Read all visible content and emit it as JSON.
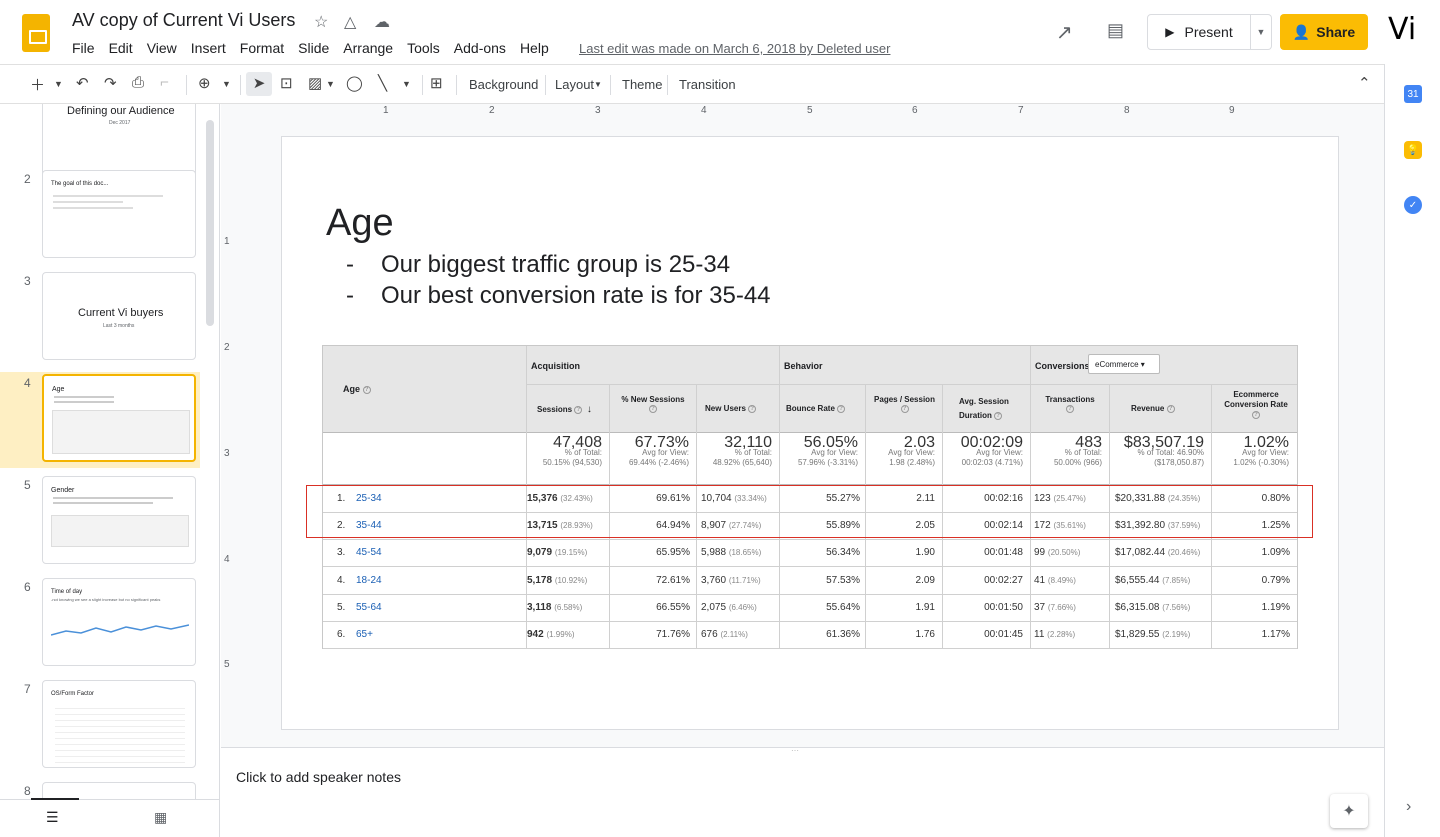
{
  "header": {
    "title": "AV copy of Current Vi Users",
    "menu": [
      "File",
      "Edit",
      "View",
      "Insert",
      "Format",
      "Slide",
      "Arrange",
      "Tools",
      "Add-ons",
      "Help"
    ],
    "last_edit": "Last edit was made on March 6, 2018 by Deleted user",
    "present_label": "Present",
    "share_label": "Share",
    "avatar_text": "Vi"
  },
  "toolbar": {
    "background": "Background",
    "layout": "Layout",
    "theme": "Theme",
    "transition": "Transition"
  },
  "filmstrip": {
    "slides": [
      {
        "num": "",
        "title": "Defining our Audience",
        "subtitle": "Dec 2017"
      },
      {
        "num": "2",
        "title": "The goal of this doc..."
      },
      {
        "num": "3",
        "title": "Current Vi buyers",
        "subtitle": "Last 3 months"
      },
      {
        "num": "4",
        "title": "Age"
      },
      {
        "num": "5",
        "title": "Gender"
      },
      {
        "num": "6",
        "title": "Time of day",
        "subtitle": "-not knowing we see a slight increase but no significant peaks"
      },
      {
        "num": "7",
        "title": "OS/Form Factor"
      },
      {
        "num": "8",
        "title": ""
      }
    ]
  },
  "ruler": {
    "h": [
      "1",
      "2",
      "3",
      "4",
      "5",
      "6",
      "7",
      "8",
      "9"
    ],
    "v": [
      "1",
      "2",
      "3",
      "4",
      "5"
    ]
  },
  "slide": {
    "title": "Age",
    "bullets": [
      "Our biggest traffic group is 25-34",
      "Our best conversion rate is for 35-44"
    ]
  },
  "table": {
    "age_header": "Age",
    "groups": {
      "acquisition": "Acquisition",
      "behavior": "Behavior",
      "conversions": "Conversions",
      "ecommerce_select": "eCommerce"
    },
    "columns": [
      "Sessions",
      "% New Sessions",
      "New Users",
      "Bounce Rate",
      "Pages / Session",
      "Avg. Session Duration",
      "Transactions",
      "Revenue",
      "Ecommerce Conversion Rate"
    ],
    "totals": [
      {
        "value": "47,408",
        "sub1": "% of Total:",
        "sub2": "50.15% (94,530)"
      },
      {
        "value": "67.73%",
        "sub1": "Avg for View:",
        "sub2": "69.44% (-2.46%)"
      },
      {
        "value": "32,110",
        "sub1": "% of Total:",
        "sub2": "48.92% (65,640)"
      },
      {
        "value": "56.05%",
        "sub1": "Avg for View:",
        "sub2": "57.96% (-3.31%)"
      },
      {
        "value": "2.03",
        "sub1": "Avg for View:",
        "sub2": "1.98 (2.48%)"
      },
      {
        "value": "00:02:09",
        "sub1": "Avg for View:",
        "sub2": "00:02:03 (4.71%)"
      },
      {
        "value": "483",
        "sub1": "% of Total:",
        "sub2": "50.00% (966)"
      },
      {
        "value": "$83,507.19",
        "sub1": "% of Total: 46.90%",
        "sub2": "($178,050.87)"
      },
      {
        "value": "1.02%",
        "sub1": "Avg for View:",
        "sub2": "1.02% (-0.30%)"
      }
    ],
    "rows": [
      {
        "idx": "1.",
        "age": "25-34",
        "sessions": "15,376",
        "sessions_pct": "(32.43%)",
        "new_sessions": "69.61%",
        "new_users": "10,704",
        "new_users_pct": "(33.34%)",
        "bounce": "55.27%",
        "pages": "2.11",
        "duration": "00:02:16",
        "transactions": "123",
        "transactions_pct": "(25.47%)",
        "revenue": "$20,331.88",
        "revenue_pct": "(24.35%)",
        "conv": "0.80%"
      },
      {
        "idx": "2.",
        "age": "35-44",
        "sessions": "13,715",
        "sessions_pct": "(28.93%)",
        "new_sessions": "64.94%",
        "new_users": "8,907",
        "new_users_pct": "(27.74%)",
        "bounce": "55.89%",
        "pages": "2.05",
        "duration": "00:02:14",
        "transactions": "172",
        "transactions_pct": "(35.61%)",
        "revenue": "$31,392.80",
        "revenue_pct": "(37.59%)",
        "conv": "1.25%"
      },
      {
        "idx": "3.",
        "age": "45-54",
        "sessions": "9,079",
        "sessions_pct": "(19.15%)",
        "new_sessions": "65.95%",
        "new_users": "5,988",
        "new_users_pct": "(18.65%)",
        "bounce": "56.34%",
        "pages": "1.90",
        "duration": "00:01:48",
        "transactions": "99",
        "transactions_pct": "(20.50%)",
        "revenue": "$17,082.44",
        "revenue_pct": "(20.46%)",
        "conv": "1.09%"
      },
      {
        "idx": "4.",
        "age": "18-24",
        "sessions": "5,178",
        "sessions_pct": "(10.92%)",
        "new_sessions": "72.61%",
        "new_users": "3,760",
        "new_users_pct": "(11.71%)",
        "bounce": "57.53%",
        "pages": "2.09",
        "duration": "00:02:27",
        "transactions": "41",
        "transactions_pct": "(8.49%)",
        "revenue": "$6,555.44",
        "revenue_pct": "(7.85%)",
        "conv": "0.79%"
      },
      {
        "idx": "5.",
        "age": "55-64",
        "sessions": "3,118",
        "sessions_pct": "(6.58%)",
        "new_sessions": "66.55%",
        "new_users": "2,075",
        "new_users_pct": "(6.46%)",
        "bounce": "55.64%",
        "pages": "1.91",
        "duration": "00:01:50",
        "transactions": "37",
        "transactions_pct": "(7.66%)",
        "revenue": "$6,315.08",
        "revenue_pct": "(7.56%)",
        "conv": "1.19%"
      },
      {
        "idx": "6.",
        "age": "65+",
        "sessions": "942",
        "sessions_pct": "(1.99%)",
        "new_sessions": "71.76%",
        "new_users": "676",
        "new_users_pct": "(2.11%)",
        "bounce": "61.36%",
        "pages": "1.76",
        "duration": "00:01:45",
        "transactions": "11",
        "transactions_pct": "(2.28%)",
        "revenue": "$1,829.55",
        "revenue_pct": "(2.19%)",
        "conv": "1.17%"
      }
    ]
  },
  "notes": {
    "placeholder": "Click to add speaker notes"
  },
  "right_panel": {
    "calendar_label": "31"
  },
  "colors": {
    "accent": "#fbbc04",
    "highlight": "#d93025",
    "link": "#1a5fb4",
    "selected_slide": "#feefc3"
  }
}
